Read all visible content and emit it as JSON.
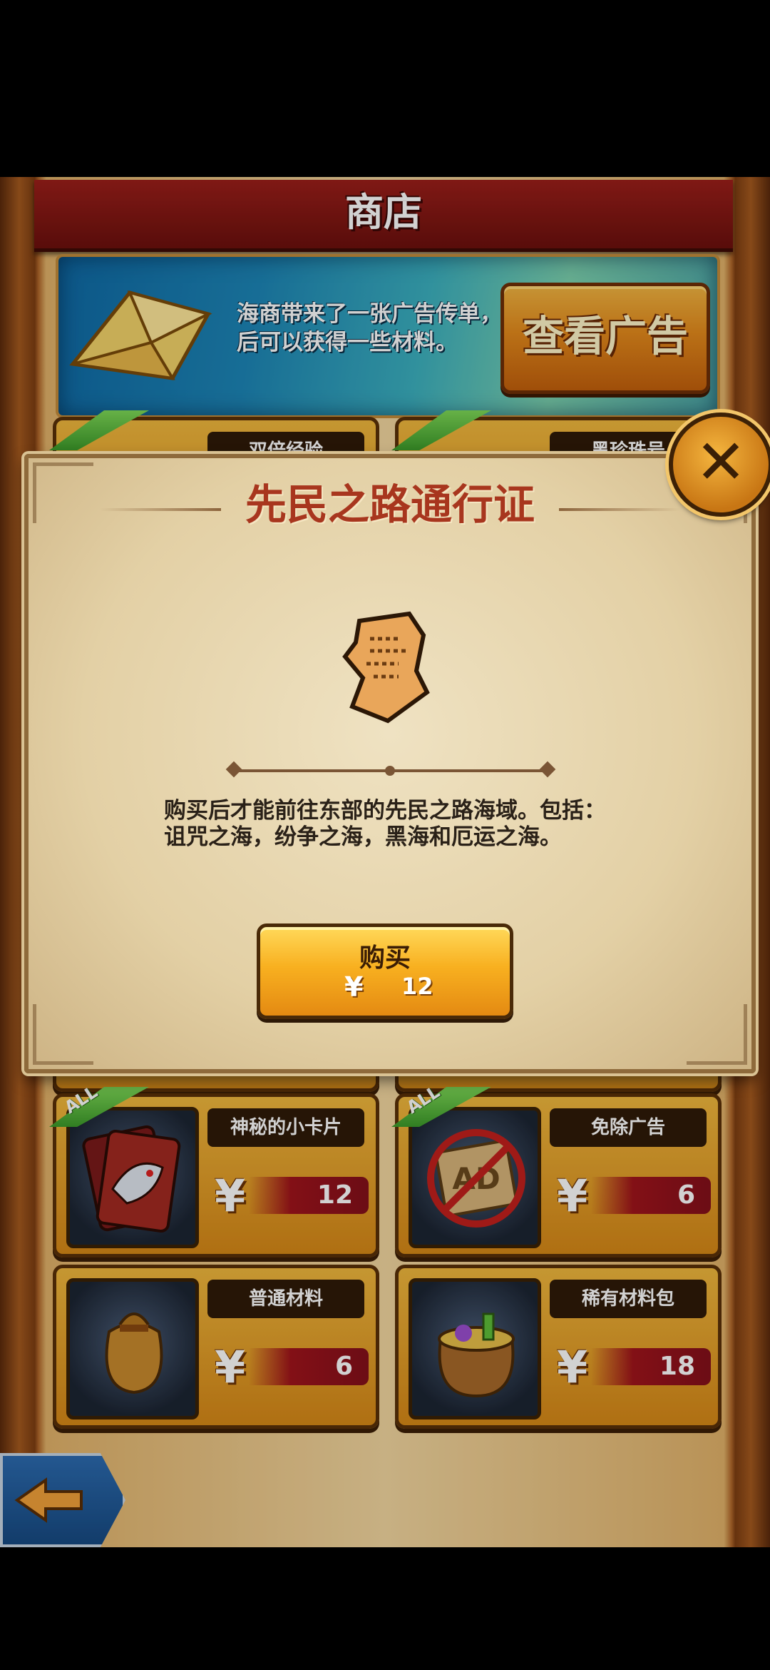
{
  "shop": {
    "title": "商店",
    "ad_banner": {
      "text": "海商带来了一张广告传单，看后可以获得一些材料。",
      "button_label": "查看广告"
    },
    "cards_partial": [
      {
        "name": "双倍经验"
      },
      {
        "name": "黑珍珠号"
      }
    ],
    "cards": [
      {
        "name": "神秘的小卡片",
        "currency": "¥",
        "price": "12",
        "badge": "ALL",
        "icon": "dragon-card-icon"
      },
      {
        "name": "免除广告",
        "currency": "¥",
        "price": "6",
        "badge": "ALL",
        "icon": "no-ads-icon"
      },
      {
        "name": "普通材料",
        "currency": "¥",
        "price": "6",
        "badge": "",
        "icon": "material-sack-icon"
      },
      {
        "name": "稀有材料包",
        "currency": "¥",
        "price": "18",
        "badge": "",
        "icon": "rare-material-bag-icon"
      }
    ],
    "back_icon": "back-arrow-icon"
  },
  "popup": {
    "title": "先民之路通行证",
    "item_icon": "parchment-scroll-icon",
    "description": "购买后才能前往东部的先民之路海域。包括：诅咒之海，纷争之海，黑海和厄运之海。",
    "buy_button": {
      "label": "购买",
      "currency": "¥",
      "price": "12"
    },
    "close_icon": "close-x-icon"
  },
  "colors": {
    "title_bar": "#8b1a16",
    "card_gold": "#e9a42a",
    "price_red": "#a0141b",
    "popup_paper": "#e6d4aa",
    "popup_title": "#a8361e",
    "badge_green": "#5cbc3c"
  }
}
